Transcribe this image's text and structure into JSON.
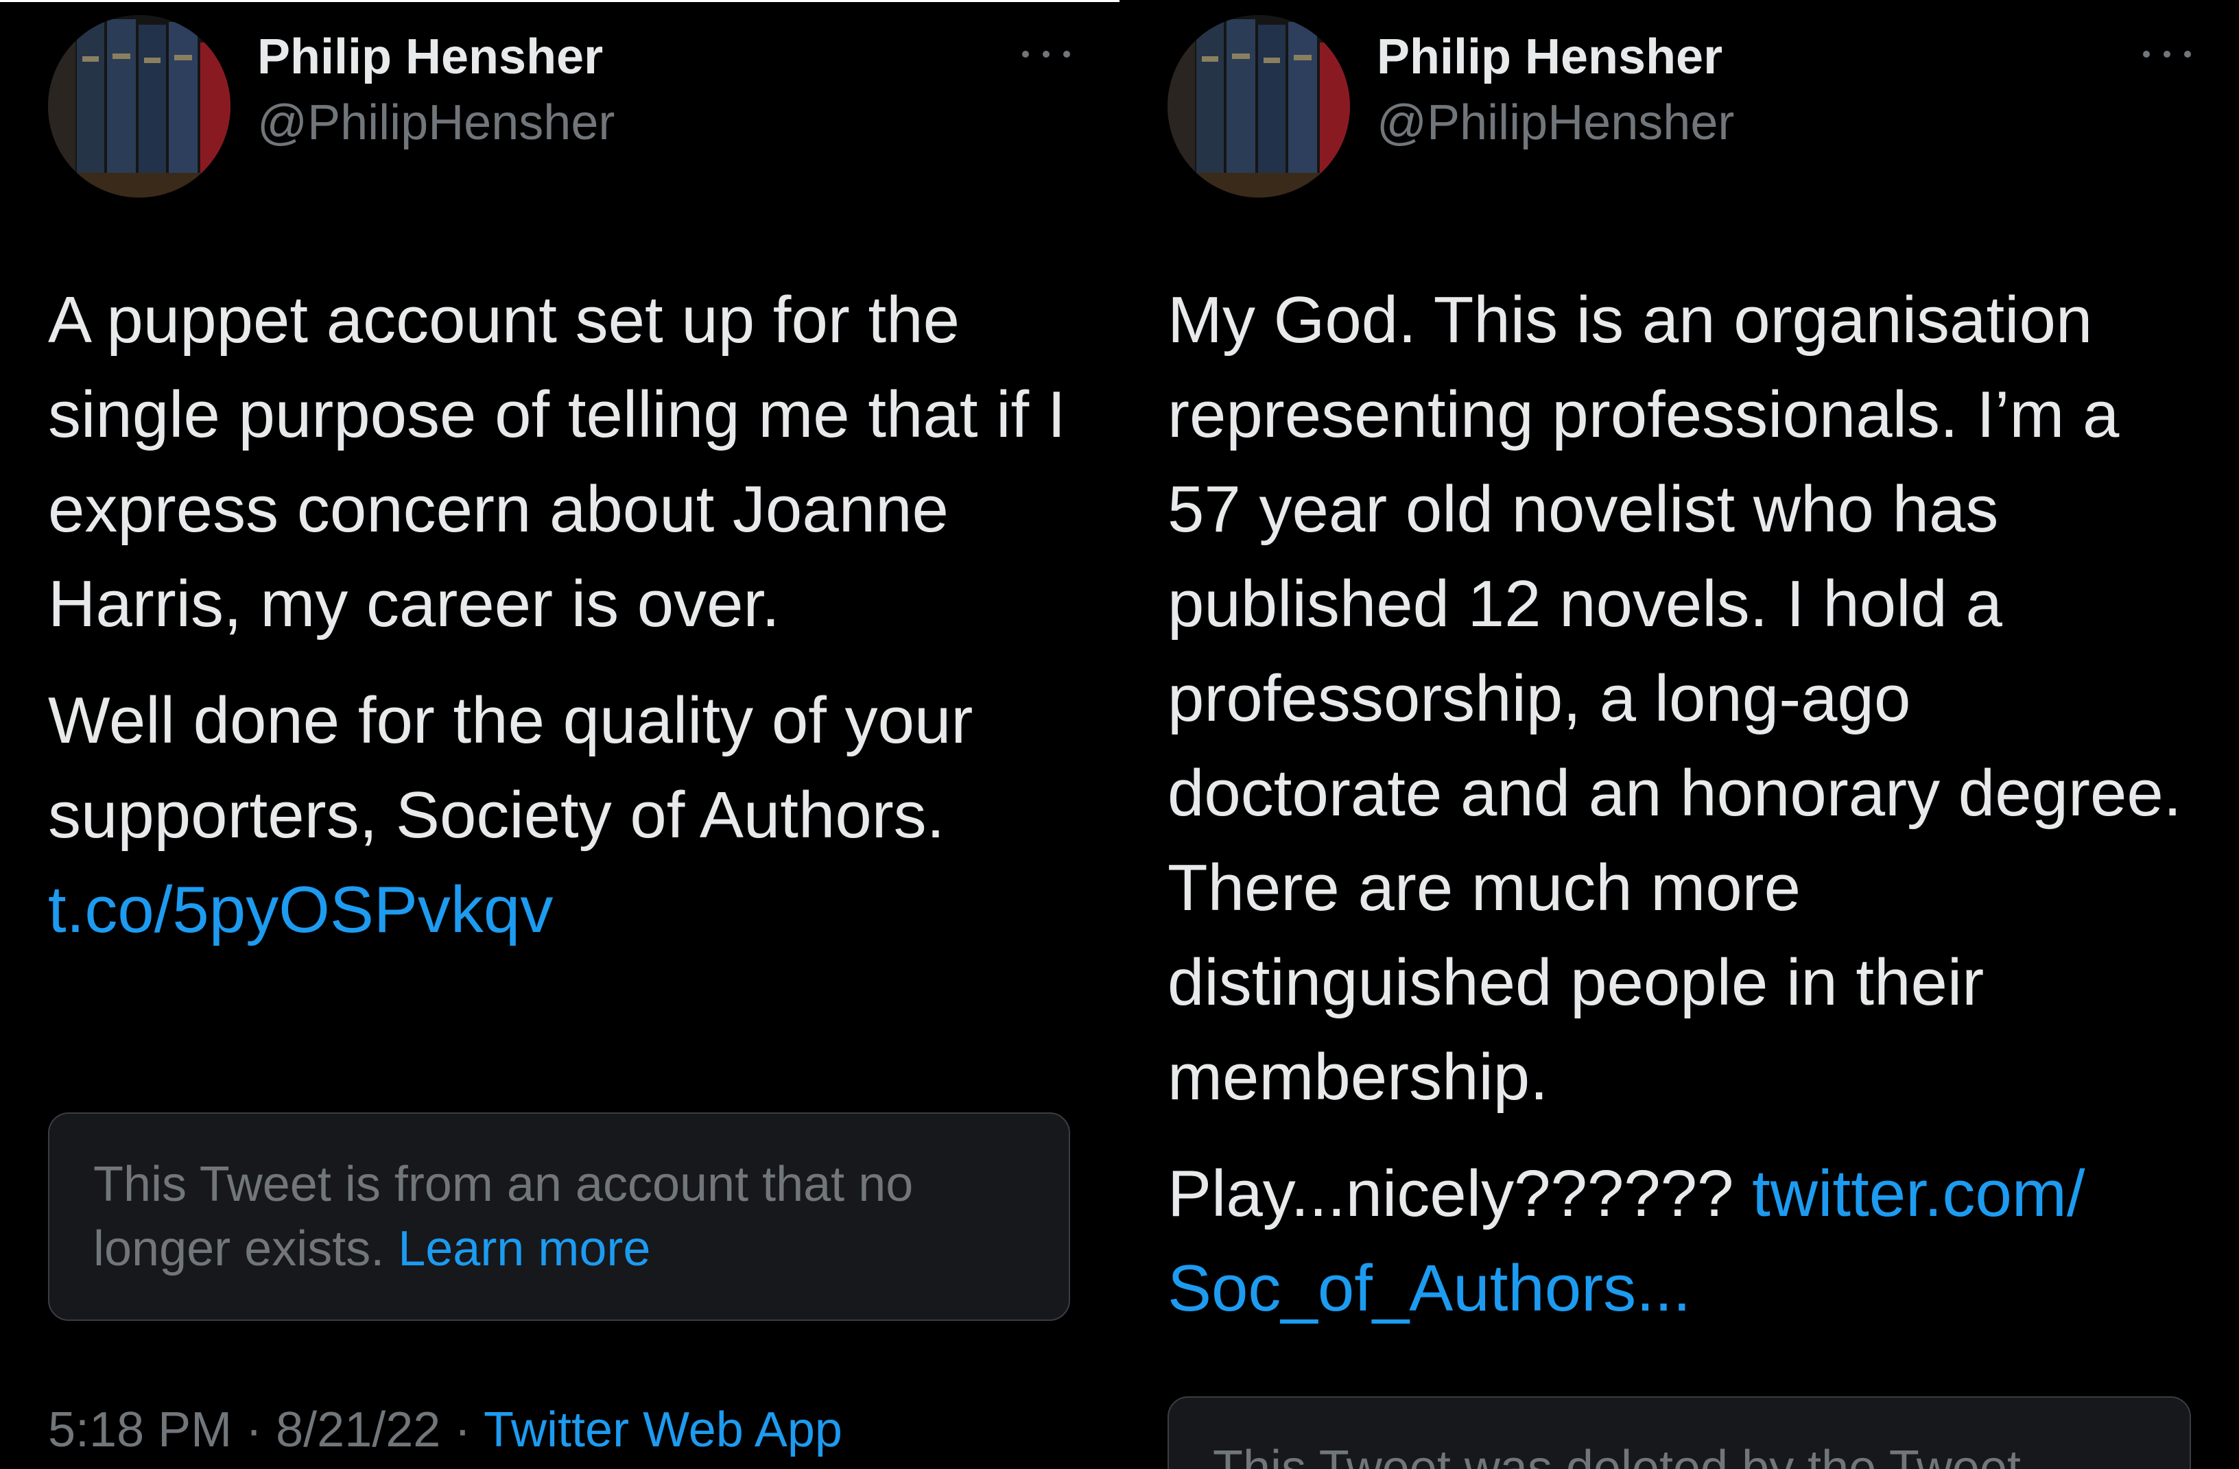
{
  "tweets": [
    {
      "author_name": "Philip Hensher",
      "author_handle": "@PhilipHensher",
      "paragraphs": [
        {
          "text": "A puppet account set up for the single purpose of telling me that if I express concern about Joanne Harris, my career is over."
        },
        {
          "text": "Well done for the quality of your supporters, Society of Authors. ",
          "link": "t.co/5pyOSPvkqv"
        }
      ],
      "quoted_notice": {
        "text": "This Tweet is from an account that no longer exists. ",
        "link": "Learn more"
      },
      "meta": {
        "time": "5:18 PM",
        "date": "8/21/22",
        "separator": " · ",
        "source": "Twitter Web App"
      }
    },
    {
      "author_name": "Philip Hensher",
      "author_handle": "@PhilipHensher",
      "paragraphs": [
        {
          "text": "My God. This is an organisation representing professionals. I’m a 57 year old novelist who has published 12 novels. I hold a professorship, a long-ago doctorate and an honorary degree. There are much more distinguished people in their membership."
        },
        {
          "text": "Play...nicely?????? ",
          "link": "twitter.com/ Soc_of_Authors..."
        }
      ],
      "quoted_notice": {
        "text": "This Tweet was deleted by the Tweet"
      }
    }
  ],
  "icons": {
    "more": "more-horizontal-icon",
    "avatar": "bookshelf-avatar-image"
  },
  "colors": {
    "background": "#000000",
    "text": "#e7e9ea",
    "secondary": "#71767b",
    "link": "#1d9bf0",
    "notice_bg": "#16181c",
    "notice_border": "#3a3d42"
  }
}
